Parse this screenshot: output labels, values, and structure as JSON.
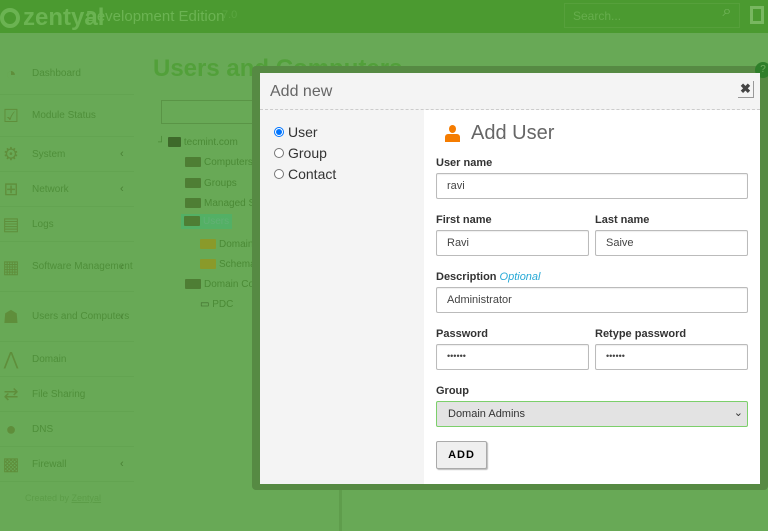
{
  "header": {
    "brand": "zentyal",
    "edition": "Development Edition",
    "version": "7.0",
    "search_placeholder": "Search..."
  },
  "sidebar": {
    "items": [
      {
        "label": "Dashboard",
        "icon": "dashboard-icon",
        "chevron": false
      },
      {
        "label": "Module Status",
        "icon": "module-status-icon",
        "chevron": false
      },
      {
        "label": "System",
        "icon": "gear-icon",
        "chevron": true
      },
      {
        "label": "Network",
        "icon": "network-icon",
        "chevron": true
      },
      {
        "label": "Logs",
        "icon": "logs-icon",
        "chevron": false
      },
      {
        "label": "Software Management",
        "icon": "package-icon",
        "chevron": true
      },
      {
        "label": "Users and Computers",
        "icon": "users-icon",
        "chevron": true
      },
      {
        "label": "Domain",
        "icon": "domain-icon",
        "chevron": false
      },
      {
        "label": "File Sharing",
        "icon": "file-sharing-icon",
        "chevron": false
      },
      {
        "label": "DNS",
        "icon": "dns-icon",
        "chevron": false
      },
      {
        "label": "Firewall",
        "icon": "firewall-icon",
        "chevron": true
      }
    ],
    "created_by": "Created by",
    "created_link": "Zentyal"
  },
  "page": {
    "title": "Users and Computers",
    "tree": {
      "root": "tecmint.com",
      "computers": "Computers",
      "groups": "Groups",
      "managed": "Managed Se",
      "users": "Users",
      "domain_admins": "Domain A",
      "schema_admins": "Schema A",
      "domain_controllers": "Domain Cont",
      "pdc": "PDC"
    }
  },
  "modal": {
    "title": "Add new",
    "types": [
      "User",
      "Group",
      "Contact"
    ],
    "selected_type": "User",
    "form_title": "Add User",
    "username_label": "User name",
    "username": "ravi",
    "firstname_label": "First name",
    "firstname": "Ravi",
    "lastname_label": "Last name",
    "lastname": "Saive",
    "description_label": "Description",
    "optional": "Optional",
    "description": "Administrator",
    "password_label": "Password",
    "password": "••••••",
    "retype_label": "Retype password",
    "retype": "••••••",
    "group_label": "Group",
    "group": "Domain Admins",
    "add_label": "ADD"
  },
  "colors": {
    "accent": "#4b9a30",
    "user_icon": "#f57c00",
    "optional": "#27a9d6"
  }
}
